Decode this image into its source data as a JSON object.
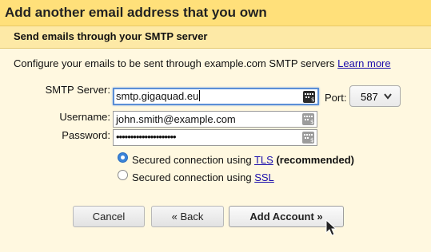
{
  "dialog": {
    "title": "Add another email address that you own",
    "subtitle": "Send emails through your SMTP server",
    "intro_text": "Configure your emails to be sent through example.com SMTP servers",
    "learn_more": "Learn more"
  },
  "form": {
    "smtp_label": "SMTP Server:",
    "smtp_value": "smtp.gigaquad.eu",
    "port_label": "Port:",
    "port_value": "587",
    "username_label": "Username:",
    "username_value": "john.smith@example.com",
    "password_label": "Password:",
    "password_value": "•••••••••••••••••••••",
    "tls_prefix": "Secured connection using ",
    "tls_link": "TLS",
    "tls_suffix": "(recommended)",
    "ssl_prefix": "Secured connection using ",
    "ssl_link": "SSL",
    "selected_security": "TLS"
  },
  "buttons": {
    "cancel": "Cancel",
    "back": "« Back",
    "add_account": "Add Account »"
  },
  "icons": {
    "keyboard": "keyboard-icon",
    "dropdown": "chevron-down-icon",
    "pointer": "mouse-pointer-icon"
  },
  "colors": {
    "title_bg": "#ffe07a",
    "subtitle_bg": "#fde9a6",
    "page_bg": "#fff8e0",
    "link": "#1a0dab",
    "focus": "#5b8fd6",
    "radio_on": "#3b84d8"
  }
}
